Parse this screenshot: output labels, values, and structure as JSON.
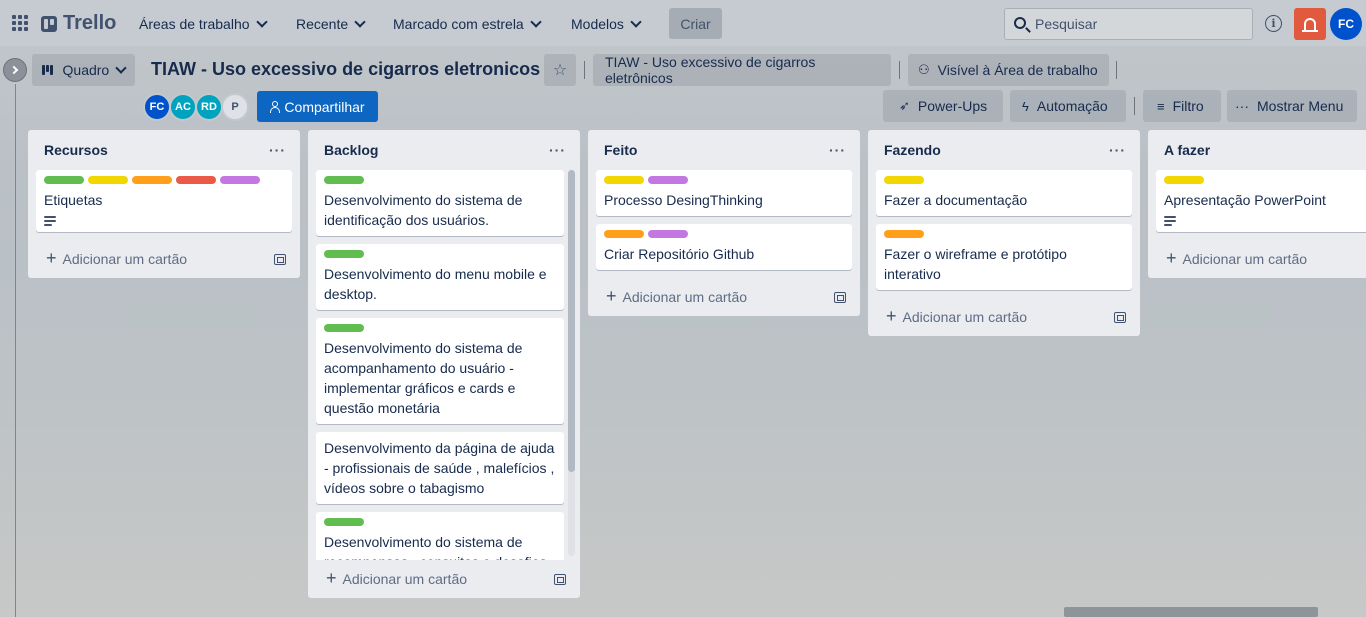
{
  "nav": {
    "logo": "Trello",
    "menus": [
      "Áreas de trabalho",
      "Recente",
      "Marcado com estrela",
      "Modelos"
    ],
    "create": "Criar",
    "search_placeholder": "Pesquisar",
    "info": "i",
    "user_initials": "FC"
  },
  "board": {
    "view": "Quadro",
    "title": "TIAW - Uso excessivo de cigarros eletronicos",
    "workspace": "TIAW - Uso excessivo de cigarros eletrônicos",
    "visibility": "Visível à Área de trabalho",
    "members": [
      {
        "initials": "FC",
        "color": "#0052cc"
      },
      {
        "initials": "AC",
        "color": "#00a3bf"
      },
      {
        "initials": "RD",
        "color": "#00a3bf"
      },
      {
        "initials": "P",
        "color": "#dfe1e6"
      }
    ],
    "share": "Compartilhar",
    "powerups": "Power-Ups",
    "automation": "Automação",
    "filter": "Filtro",
    "show_menu": "Mostrar Menu"
  },
  "label_colors": {
    "green": "#61bd4f",
    "yellow": "#f2d600",
    "orange": "#ff9f1a",
    "red": "#eb5a46",
    "purple": "#c377e0"
  },
  "add_card": "Adicionar um cartão",
  "lists": [
    {
      "title": "Recursos",
      "cards": [
        {
          "labels": [
            "green",
            "yellow",
            "orange",
            "red",
            "purple"
          ],
          "title": "Etiquetas",
          "desc": true
        }
      ]
    },
    {
      "title": "Backlog",
      "cards": [
        {
          "labels": [
            "green"
          ],
          "title": "Desenvolvimento do sistema de identificação dos usuários."
        },
        {
          "labels": [
            "green"
          ],
          "title": "Desenvolvimento do menu mobile e desktop."
        },
        {
          "labels": [
            "green"
          ],
          "title": "Desenvolvimento do sistema de acompanhamento do usuário - implementar gráficos e cards e questão monetária"
        },
        {
          "labels": [],
          "title": "Desenvolvimento da página de ajuda - profissionais de saúde , malefícios , vídeos sobre o tabagismo"
        },
        {
          "labels": [
            "green"
          ],
          "title": "Desenvolvimento do sistema de recompensas , consuitas e desafios"
        }
      ]
    },
    {
      "title": "Feito",
      "cards": [
        {
          "labels": [
            "yellow",
            "purple"
          ],
          "title": "Processo DesingThinking"
        },
        {
          "labels": [
            "orange",
            "purple"
          ],
          "title": "Criar Repositório Github"
        }
      ]
    },
    {
      "title": "Fazendo",
      "cards": [
        {
          "labels": [
            "yellow"
          ],
          "title": "Fazer a documentação"
        },
        {
          "labels": [
            "orange"
          ],
          "title": "Fazer o wireframe e protótipo interativo"
        }
      ]
    },
    {
      "title": "A fazer",
      "cards": [
        {
          "labels": [
            "yellow"
          ],
          "title": "Apresentação PowerPoint",
          "desc": true
        }
      ]
    }
  ]
}
